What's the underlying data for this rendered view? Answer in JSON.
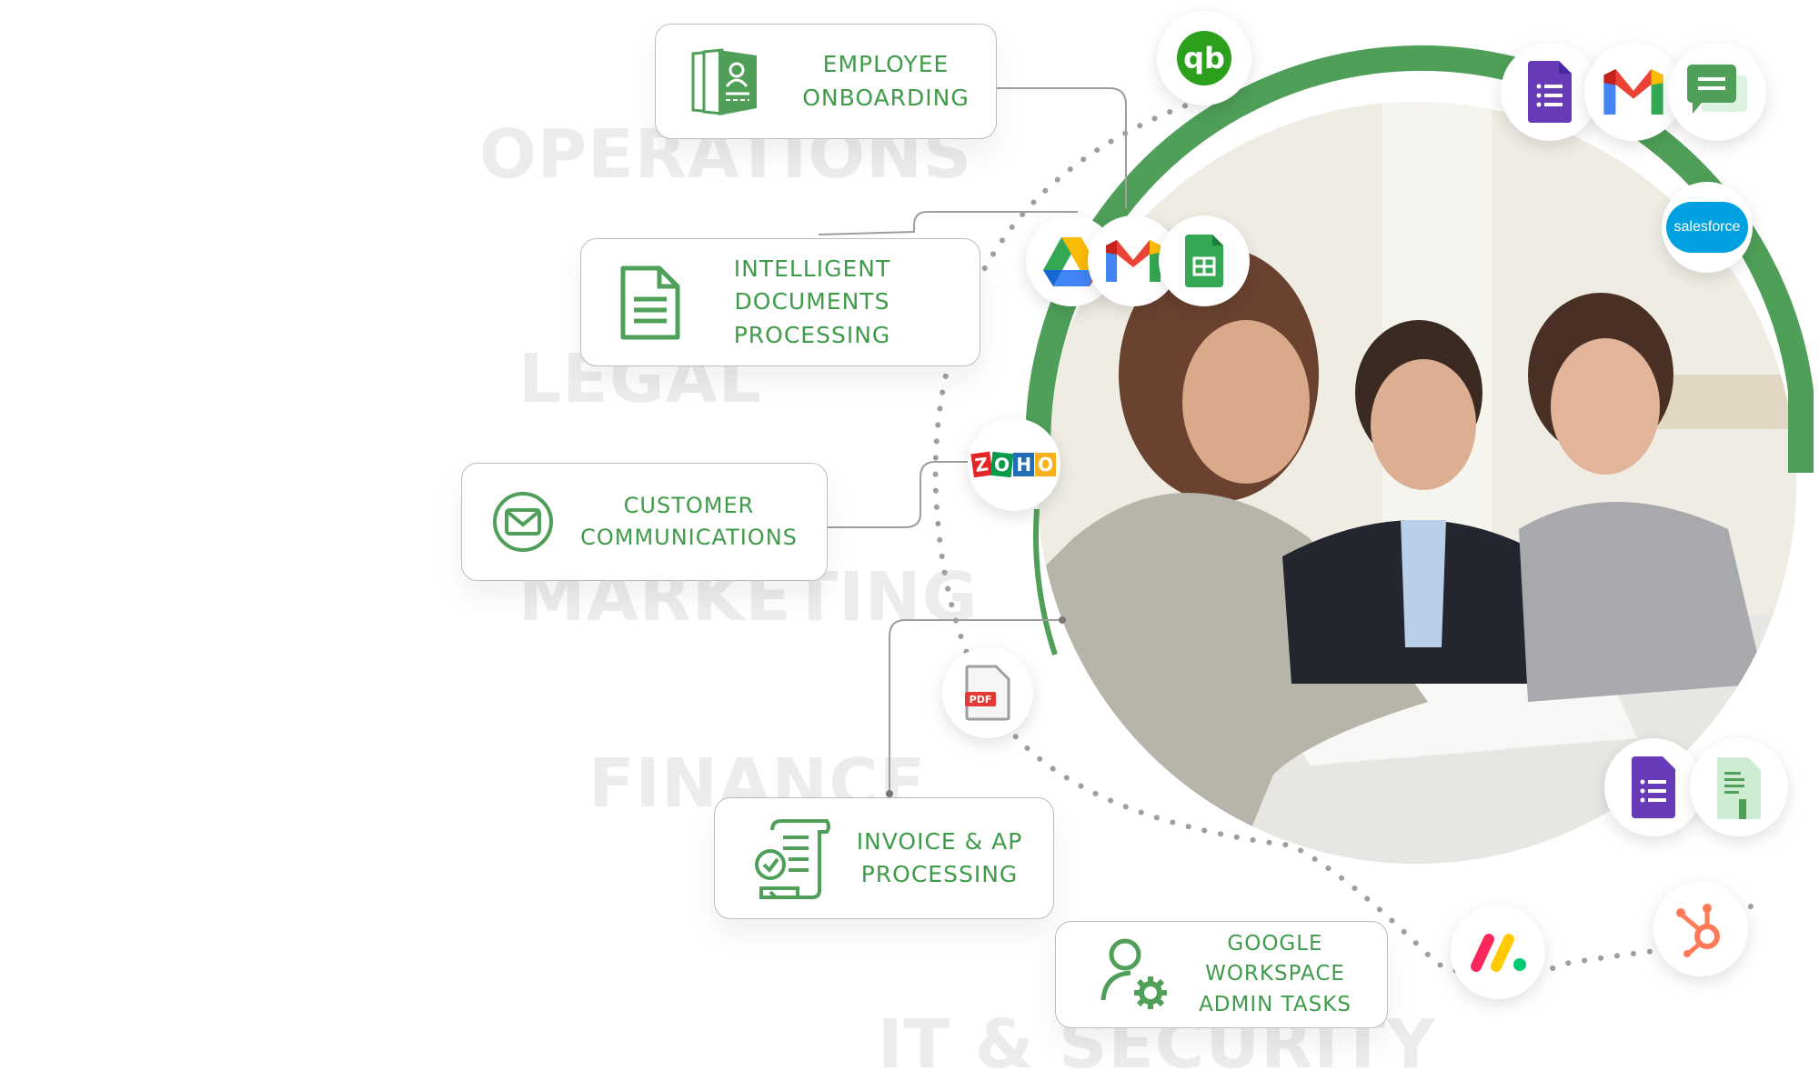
{
  "background_words": [
    "OPERATIONS",
    "LEGAL",
    "MARKETING",
    "FINANCE",
    "IT & SECURITY"
  ],
  "cards": [
    {
      "id": "employee-onboarding",
      "lines": [
        "EMPLOYEE",
        "ONBOARDING"
      ],
      "icon": "employee-files-icon"
    },
    {
      "id": "intelligent-documents",
      "lines": [
        "INTELLIGENT",
        "DOCUMENTS",
        "PROCESSING"
      ],
      "icon": "document-icon"
    },
    {
      "id": "customer-communications",
      "lines": [
        "CUSTOMER",
        "COMMUNICATIONS"
      ],
      "icon": "envelope-icon"
    },
    {
      "id": "invoice-ap",
      "lines": [
        "INVOICE & AP",
        "PROCESSING"
      ],
      "icon": "receipt-check-icon"
    },
    {
      "id": "google-workspace",
      "lines": [
        "GOOGLE",
        "WORKSPACE",
        "ADMIN TASKS"
      ],
      "icon": "user-gear-icon"
    }
  ],
  "integrations": {
    "quickbooks": "qb",
    "zoho": "ZOHO",
    "salesforce": "salesforce",
    "pdf": "PDF"
  },
  "colors": {
    "accent_green": "#4f9f58",
    "text_green": "#3f9b49",
    "card_border": "#bdbdbd",
    "watermark": "#ececec"
  }
}
